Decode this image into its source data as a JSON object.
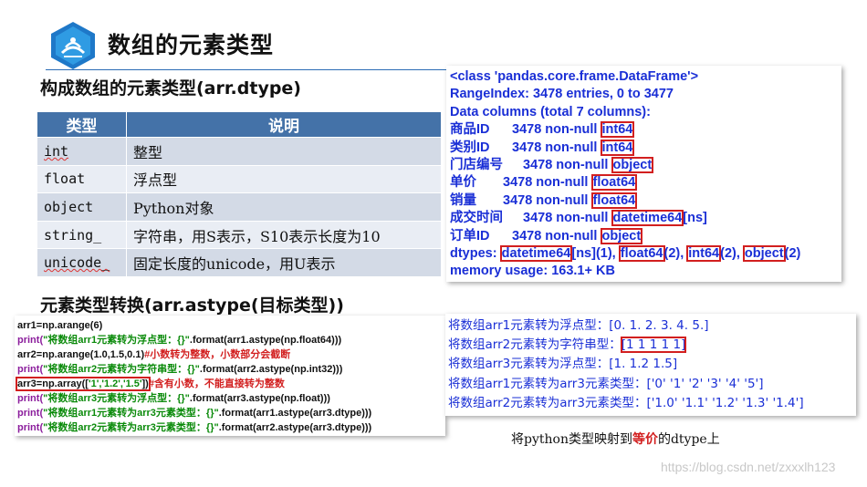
{
  "slide": {
    "title": "数组的元素类型",
    "section1": "构成数组的元素类型(arr.dtype)",
    "section2": "元素类型转换(arr.astype(目标类型))"
  },
  "type_table": {
    "headers": [
      "类型",
      "说明"
    ],
    "rows": [
      {
        "type": "int",
        "desc": "整型"
      },
      {
        "type": "float",
        "desc": "浮点型"
      },
      {
        "type": "object",
        "desc": "Python对象"
      },
      {
        "type": "string_",
        "desc": "字符串，用S表示，S10表示长度为10"
      },
      {
        "type": "unicode_",
        "desc": "固定长度的unicode，用U表示"
      }
    ]
  },
  "info": {
    "line1": "<class 'pandas.core.frame.DataFrame'>",
    "line2": "RangeIndex: 3478 entries, 0 to 3477",
    "line3": "Data columns (total 7 columns):",
    "columns": [
      {
        "name": "商品ID",
        "count": "3478 non-null",
        "dtype": "int64",
        "extra": ""
      },
      {
        "name": "类别ID",
        "count": "3478 non-null",
        "dtype": "int64",
        "extra": ""
      },
      {
        "name": "门店编号",
        "count": "3478 non-null",
        "dtype": "object",
        "extra": ""
      },
      {
        "name": "单价",
        "count": "3478 non-null",
        "dtype": "float64",
        "extra": ""
      },
      {
        "name": "销量",
        "count": "3478 non-null",
        "dtype": "float64",
        "extra": ""
      },
      {
        "name": "成交时间",
        "count": "3478 non-null",
        "dtype": "datetime64",
        "extra": "[ns]"
      },
      {
        "name": "订单ID",
        "count": "3478 non-null",
        "dtype": "object",
        "extra": ""
      }
    ],
    "dtypes_label": "dtypes:",
    "dtypes": [
      {
        "name": "datetime64",
        "suffix": "[ns](1),"
      },
      {
        "name": "float64",
        "suffix": "(2),"
      },
      {
        "name": "int64",
        "suffix": "(2),"
      },
      {
        "name": "object",
        "suffix": "(2)"
      }
    ],
    "memory": "memory usage: 163.1+ KB"
  },
  "code": {
    "l1": "arr1=np.arange(6)",
    "l2_print": "print(",
    "l2_str": "\"将数组arr1元素转为浮点型：{}\"",
    "l2_rest": ".format(arr1.astype(np.float64)))",
    "l3_code": "arr2=np.arange(1.0,1.5,0.1)",
    "l3_comment": "#小数转为整数，小数部分会截断",
    "l4_print": "print(",
    "l4_str": "\"将数组arr2元素转为字符串型：{}\"",
    "l4_rest": ".format(arr2.astype(np.int32)))",
    "l5_code": "arr3=np.array([",
    "l5_str": "'1','1.2','1.5'",
    "l5_end": "])",
    "l5_comment": "#含有小数，不能直接转为整数",
    "l6_print": "print(",
    "l6_str": "\"将数组arr3元素转为浮点型：{}\"",
    "l6_rest": ".format(arr3.astype(np.float)))",
    "l7_print": "print(",
    "l7_str": "\"将数组arr1元素转为arr3元素类型：{}\"",
    "l7_rest": ".format(arr1.astype(arr3.dtype)))",
    "l8_print": "print(",
    "l8_str": "\"将数组arr2元素转为arr3元素类型：{}\"",
    "l8_rest": ".format(arr2.astype(arr3.dtype)))"
  },
  "output": {
    "l1": "将数组arr1元素转为浮点型：[0. 1. 2. 3. 4. 5.]",
    "l2_prefix": "将数组arr2元素转为字符串型：",
    "l2_value": "[1 1 1 1 1]",
    "l3": "将数组arr3元素转为浮点型：[1.  1.2 1.5]",
    "l4": "将数组arr1元素转为arr3元素类型：['0' '1' '2' '3' '4' '5']",
    "l5": "将数组arr2元素转为arr3元素类型：['1.0' '1.1' '1.2' '1.3' '1.4']"
  },
  "caption": {
    "before": "将python类型映射到",
    "emph": "等价",
    "after": "的dtype上"
  },
  "watermark": "https://blog.csdn.net/zxxxlh123",
  "colors": {
    "accent_blue": "#1a2fd6",
    "table_header": "#4472a8",
    "highlight_red": "#d21f1f",
    "code_green": "#0a8a0a"
  }
}
